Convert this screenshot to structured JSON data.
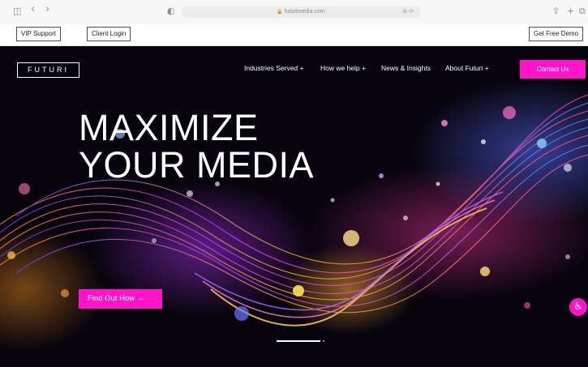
{
  "browser": {
    "url": "futurimedia.com",
    "icons": [
      "sidebar-icon",
      "back-icon",
      "forward-icon",
      "privacy-icon",
      "extensions-icon",
      "share-icon",
      "new-tab-icon",
      "tabs-icon"
    ],
    "glyphs": {
      "sidebar": "◫",
      "back": "‹",
      "forward": "›",
      "privacy": "◐",
      "lock": "🔒",
      "ext": "⊛ ⟳",
      "share": "⇧",
      "newtab": "+",
      "tabs": "⧉"
    }
  },
  "utility_bar": {
    "vip_support": "VIP Support",
    "client_login": "Client Login",
    "get_demo": "Get Free Demo"
  },
  "header": {
    "logo": "FUTURI",
    "nav": [
      {
        "label": "Industries Served +"
      },
      {
        "label": "How we help +"
      },
      {
        "label": "News & Insights"
      },
      {
        "label": "About Futuri +"
      }
    ],
    "contact": "Contact Us"
  },
  "hero": {
    "headline_line1": "MAXIMIZE",
    "headline_line2": "YOUR MEDIA",
    "cta": "Find Out How →",
    "slides_total": 2,
    "active_slide": 1
  },
  "accessibility_button": {
    "icon": "accessibility-icon",
    "glyph": "♿"
  },
  "colors": {
    "accent": "#ff14c8",
    "hero_bg": "#07040d",
    "text_light": "#ffffff"
  }
}
